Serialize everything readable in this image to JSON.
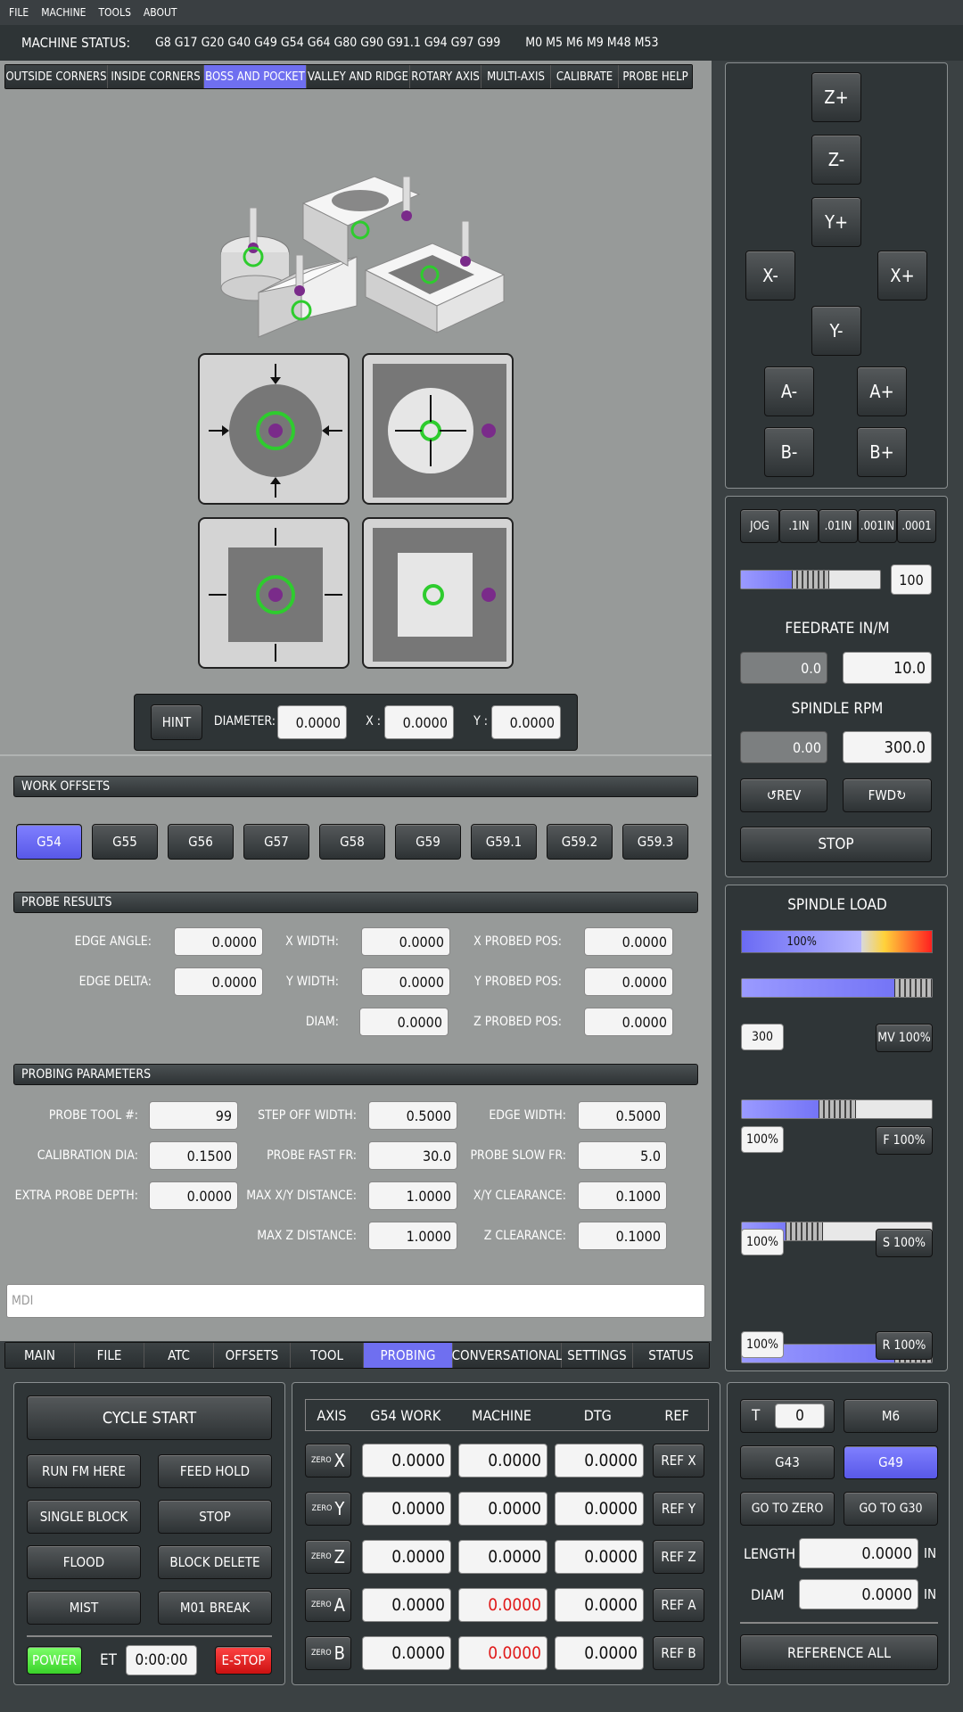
{
  "menu": [
    "FILE",
    "MACHINE",
    "TOOLS",
    "ABOUT"
  ],
  "status": {
    "label": "MACHINE STATUS:",
    "gcodes": "G8 G17 G20 G40 G49 G54 G64 G80 G90 G91.1 G94 G97 G99",
    "mcodes": "M0 M5 M6 M9 M48 M53"
  },
  "probe_tabs": [
    "OUTSIDE CORNERS",
    "INSIDE CORNERS",
    "BOSS AND POCKET",
    "VALLEY AND RIDGE",
    "ROTARY AXIS",
    "MULTI-AXIS",
    "CALIBRATE",
    "PROBE HELP"
  ],
  "probe_inputs": {
    "hint": "HINT",
    "diameter_label": "DIAMETER:",
    "diameter": "0.0000",
    "x_label": "X :",
    "x": "0.0000",
    "y_label": "Y :",
    "y": "0.0000"
  },
  "work_offsets": {
    "title": "WORK OFFSETS",
    "items": [
      "G54",
      "G55",
      "G56",
      "G57",
      "G58",
      "G59",
      "G59.1",
      "G59.2",
      "G59.3"
    ]
  },
  "probe_results": {
    "title": "PROBE RESULTS",
    "edge_angle_label": "EDGE ANGLE:",
    "edge_angle": "0.0000",
    "x_width_label": "X WIDTH:",
    "x_width": "0.0000",
    "x_probed_label": "X PROBED POS:",
    "x_probed": "0.0000",
    "edge_delta_label": "EDGE DELTA:",
    "edge_delta": "0.0000",
    "y_width_label": "Y WIDTH:",
    "y_width": "0.0000",
    "y_probed_label": "Y PROBED POS:",
    "y_probed": "0.0000",
    "diam_label": "DIAM:",
    "diam": "0.0000",
    "z_probed_label": "Z PROBED POS:",
    "z_probed": "0.0000"
  },
  "probing_params": {
    "title": "PROBING PARAMETERS",
    "probe_tool_label": "PROBE TOOL #:",
    "probe_tool": "99",
    "step_off_label": "STEP OFF WIDTH:",
    "step_off": "0.5000",
    "edge_width_label": "EDGE WIDTH:",
    "edge_width": "0.5000",
    "cal_dia_label": "CALIBRATION DIA:",
    "cal_dia": "0.1500",
    "fast_fr_label": "PROBE FAST FR:",
    "fast_fr": "30.0",
    "slow_fr_label": "PROBE SLOW FR:",
    "slow_fr": "5.0",
    "extra_depth_label": "EXTRA PROBE DEPTH:",
    "extra_depth": "0.0000",
    "max_xy_label": "MAX X/Y DISTANCE:",
    "max_xy": "1.0000",
    "xy_clear_label": "X/Y CLEARANCE:",
    "xy_clear": "0.1000",
    "max_z_label": "MAX Z DISTANCE:",
    "max_z": "1.0000",
    "z_clear_label": "Z CLEARANCE:",
    "z_clear": "0.1000"
  },
  "mdi_placeholder": "MDI",
  "main_tabs": [
    "MAIN",
    "FILE",
    "ATC",
    "OFFSETS",
    "TOOL",
    "PROBING",
    "CONVERSATIONAL",
    "SETTINGS",
    "STATUS"
  ],
  "jog_buttons": {
    "zp": "Z+",
    "zm": "Z-",
    "yp": "Y+",
    "ym": "Y-",
    "xm": "X-",
    "xp": "X+",
    "am": "A-",
    "ap": "A+",
    "bm": "B-",
    "bp": "B+"
  },
  "jog_panel": {
    "increments": [
      "JOG",
      ".1IN",
      ".01IN",
      ".001IN",
      ".0001"
    ],
    "jog_value": "100",
    "jog_fraction": 0.5,
    "feed_title": "FEEDRATE IN/M",
    "feed_actual": "0.0",
    "feed_set": "10.0",
    "spindle_title": "SPINDLE RPM",
    "spindle_actual": "0.00",
    "spindle_set": "300.0",
    "rev": "REV",
    "fwd": "FWD",
    "stop": "STOP"
  },
  "spindle_load": {
    "title": "SPINDLE LOAD",
    "load": "100%",
    "load_fraction": 0.63,
    "mv_value": "300",
    "mv_label": "MV 100%",
    "mv_fraction": 1.0,
    "f_value": "100%",
    "f_label": "F 100%",
    "f_fraction": 0.5,
    "s_value": "100%",
    "s_label": "S 100%",
    "s_fraction": 0.33,
    "r_value": "100%",
    "r_label": "R 100%",
    "r_fraction": 1.0
  },
  "controls": {
    "cycle_start": "CYCLE START",
    "run_from_here": "RUN FM HERE",
    "feed_hold": "FEED HOLD",
    "single_block": "SINGLE BLOCK",
    "stop": "STOP",
    "flood": "FLOOD",
    "block_delete": "BLOCK DELETE",
    "mist": "MIST",
    "m01_break": "M01 BREAK",
    "power": "POWER",
    "et_label": "ET",
    "et": "0:00:00",
    "estop": "E-STOP"
  },
  "dro": {
    "headers": [
      "AXIS",
      "G54 WORK",
      "MACHINE",
      "DTG",
      "REF"
    ],
    "zero_label": "ZERO",
    "rows": [
      {
        "axis": "X",
        "work": "0.0000",
        "machine": "0.0000",
        "dtg": "0.0000",
        "ref": "REF X"
      },
      {
        "axis": "Y",
        "work": "0.0000",
        "machine": "0.0000",
        "dtg": "0.0000",
        "ref": "REF Y"
      },
      {
        "axis": "Z",
        "work": "0.0000",
        "machine": "0.0000",
        "dtg": "0.0000",
        "ref": "REF Z"
      },
      {
        "axis": "A",
        "work": "0.0000",
        "machine": "0.0000",
        "dtg": "0.0000",
        "ref": "REF A"
      },
      {
        "axis": "B",
        "work": "0.0000",
        "machine": "0.0000",
        "dtg": "0.0000",
        "ref": "REF B"
      }
    ]
  },
  "tool": {
    "t_label": "T",
    "t_value": "0",
    "m6": "M6",
    "g43": "G43",
    "g49": "G49",
    "go_zero": "GO TO ZERO",
    "go_g30": "GO TO G30",
    "length_label": "LENGTH",
    "length": "0.0000",
    "length_unit": "IN",
    "diam_label": "DIAM",
    "diam": "0.0000",
    "diam_unit": "IN",
    "reference_all": "REFERENCE ALL"
  },
  "colors": {
    "active_blue": "#6f6ff0",
    "bg_gray": "#979a99",
    "panel_dark": "#2f3537",
    "green": "#2ecc2e",
    "purple": "#7a2b8a"
  }
}
